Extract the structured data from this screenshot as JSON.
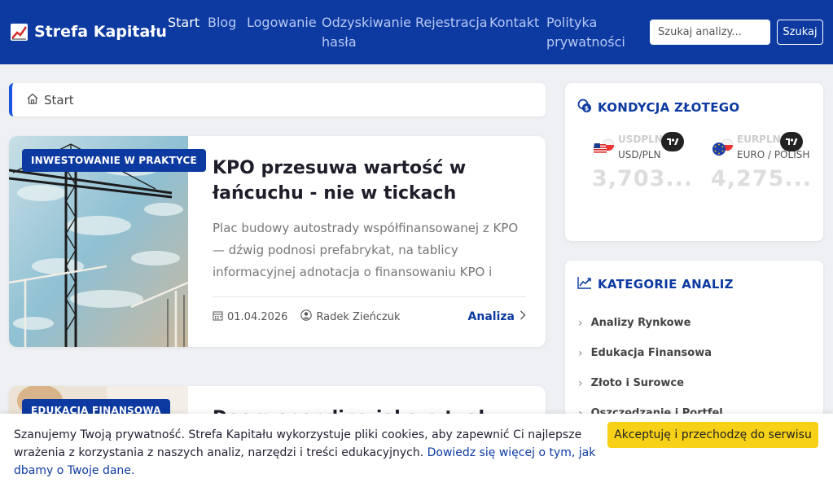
{
  "nav": {
    "brand": "Strefa Kapitału",
    "items": [
      {
        "label": "Start"
      },
      {
        "label": "Blog"
      },
      {
        "label": "Logowanie"
      },
      {
        "label": "Odzyskiwanie",
        "label2": "hasła"
      },
      {
        "label": "Rejestracja"
      },
      {
        "label": "Kontakt"
      },
      {
        "label": "Polityka",
        "label2": "prywatności"
      }
    ],
    "search_placeholder": "Szukaj analizy...",
    "search_button": "Szukaj"
  },
  "breadcrumb": {
    "label": "Start"
  },
  "articles": [
    {
      "category": "INWESTOWANIE W PRAKTYCE",
      "title": "KPO przesuwa wartość w łańcuchu - nie w tickach",
      "excerpt": "Plac budowy autostrady współfinansowanej z KPO — dźwig podnosi prefabrykat, na tablicy informacyjnej adnotacja o finansowaniu KPO i twardy cel makro PK...",
      "date": "01.04.2026",
      "author": "Radek Zieńczuk",
      "read_label": "Analiza"
    },
    {
      "category": "EDUKACJA FINANSOWA",
      "title": "Doom spending jako rytuał"
    }
  ],
  "sidebar": {
    "currency_title": "KONDYCJA ZŁOTEGO",
    "tickers": [
      {
        "symbol": "USDPLN",
        "name": "USD/PLN",
        "value": "3,703..."
      },
      {
        "symbol": "EURPLN",
        "name": "EURO / POLISH",
        "value": "4,275..."
      }
    ],
    "categories_title": "KATEGORIE ANALIZ",
    "categories": [
      "Analizy Rynkowe",
      "Edukacja Finansowa",
      "Złoto i Surowce",
      "Oszczędzanie i Portfel"
    ]
  },
  "cookie": {
    "text": "Szanujemy Twoją prywatność. Strefa Kapitału wykorzystuje pliki cookies, aby zapewnić Ci najlepsze wrażenia z korzystania z naszych analiz, narzędzi i treści edukacyjnych. ",
    "link": "Dowiedz się więcej o tym, jak dbamy o Twoje dane.",
    "button": "Akceptuję i przechodzę do serwisu"
  },
  "colors": {
    "brand_blue": "#0d3aa0",
    "accent_yellow": "#f7d117",
    "breadcrumb_accent": "#1a56db"
  }
}
